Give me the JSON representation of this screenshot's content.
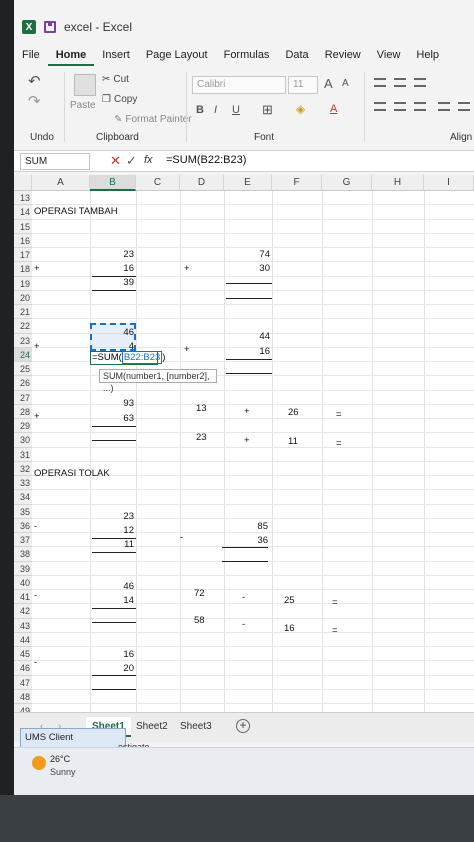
{
  "window": {
    "title": "excel - Excel",
    "app_icon": "excel-icon",
    "save_icon": "save-icon"
  },
  "menu": [
    "File",
    "Home",
    "Insert",
    "Page Layout",
    "Formulas",
    "Data",
    "Review",
    "View",
    "Help"
  ],
  "ribbon": {
    "undo_label": "Undo",
    "paste_label": "Paste",
    "cut_label": "Cut",
    "copy_label": "Copy",
    "format_painter_label": "Format Painter",
    "clipboard_label": "Clipboard",
    "font_name": "Calibri",
    "font_size": "11",
    "grow_font": "A",
    "shrink_font": "A",
    "bold": "B",
    "italic": "I",
    "underline": "U",
    "font_color_glyph": "A",
    "font_group_label": "Font",
    "align_label": "Align"
  },
  "formula_bar": {
    "name_box": "SUM",
    "cancel": "✕",
    "enter": "✓",
    "fx": "fx",
    "formula": "=SUM(B22:B23)"
  },
  "columns": [
    "A",
    "B",
    "C",
    "D",
    "E",
    "F",
    "G",
    "H",
    "I"
  ],
  "selected_column": "B",
  "rows": [
    "13",
    "14",
    "15",
    "16",
    "17",
    "18",
    "19",
    "20",
    "21",
    "22",
    "23",
    "24",
    "25",
    "26",
    "27",
    "28",
    "29",
    "30",
    "31",
    "32",
    "33",
    "34",
    "35",
    "36",
    "37",
    "38",
    "39",
    "40",
    "41",
    "42",
    "43",
    "44",
    "45",
    "46",
    "47",
    "48",
    "49"
  ],
  "selected_row": "24",
  "cells": {
    "a14": "OPERASI TAMBAH",
    "b17": "23",
    "b18": "16",
    "b19": "39",
    "a18": "+",
    "d18": "+",
    "e17": "74",
    "e18": "30",
    "b22": "46",
    "b23": "4",
    "a23": "+",
    "d23": "+",
    "e22": "44",
    "e23": "16",
    "b28a": "93",
    "b28b": "63",
    "a28": "+",
    "d28": "13",
    "e28": "+",
    "f28": "26",
    "g28": "=",
    "d30": "23",
    "e30": "+",
    "f30": "11",
    "g30": "=",
    "a32": "OPERASI TOLAK",
    "b35": "23",
    "b36": "12",
    "b37": "11",
    "a36": "-",
    "d37": "-",
    "e36": "85",
    "e37": "36",
    "b40": "46",
    "b41": "14",
    "a41": "-",
    "d41": "72",
    "e41": "-",
    "f41": "25",
    "g41": "=",
    "d43": "58",
    "e43": "-",
    "f43": "16",
    "g43": "=",
    "b45": "16",
    "b46": "20",
    "a46": "-"
  },
  "edit": {
    "prefix": "=SUM(",
    "ref": "B22:B23",
    "suffix": ")",
    "tooltip": "SUM(number1, [number2], ...)"
  },
  "sheets": [
    "Sheet1",
    "Sheet2",
    "Sheet3"
  ],
  "active_sheet": "Sheet1",
  "popup": {
    "text": "UMS Client",
    "sub": "estigate"
  },
  "weather": {
    "temp": "26°C",
    "condition": "Sunny"
  }
}
